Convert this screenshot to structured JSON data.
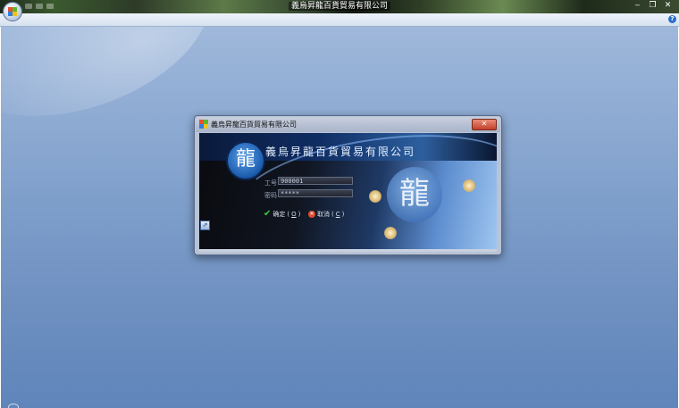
{
  "window": {
    "title": "義烏昇龍百貨貿易有限公司",
    "controls": {
      "minimize": "‒",
      "maximize": "❐",
      "close": "✕"
    },
    "help": "?"
  },
  "dialog": {
    "title": "義烏昇龍百貨貿易有限公司",
    "close": "✕",
    "company_name": "義烏昇龍百貨貿易有限公司",
    "logo_glyph": "龍",
    "fields": {
      "job_no": {
        "label": "工号",
        "value": "900001"
      },
      "password": {
        "label": "密码",
        "value": "*****"
      }
    },
    "buttons": {
      "ok": {
        "label": "确定",
        "accel": "O"
      },
      "cancel": {
        "label": "取消",
        "accel": "C"
      }
    },
    "side_icon": "⇗"
  },
  "colors": {
    "desktop_bg": "#7f9fcb",
    "dialog_bg": "#b9c3d6",
    "close_button": "#c3412a",
    "ok_icon": "#35d13a",
    "cancel_icon": "#e04a2c"
  },
  "icons": [
    "app-orb-icon",
    "check-icon",
    "cancel-icon",
    "help-icon",
    "app-launch-icon"
  ]
}
